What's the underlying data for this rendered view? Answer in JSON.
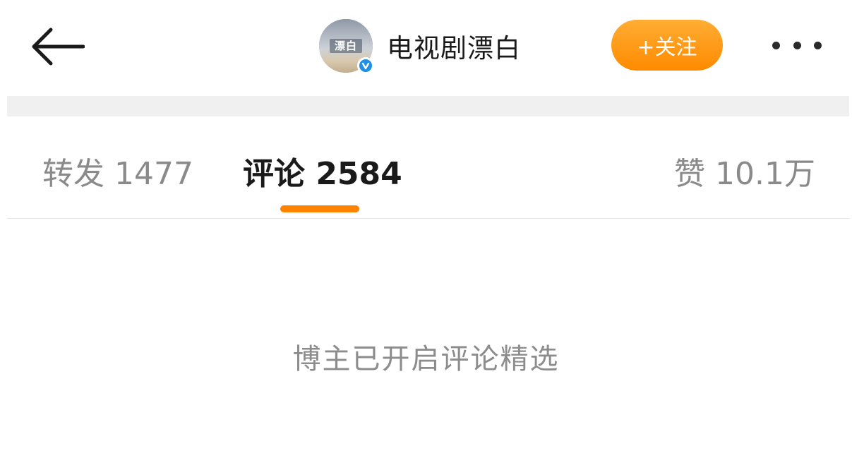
{
  "header": {
    "account_name": "电视剧漂白",
    "avatar_text": "漂白",
    "follow_label": "+关注"
  },
  "tabs": {
    "repost": "转发 1477",
    "comments": "评论 2584",
    "likes": "赞 10.1万"
  },
  "notice": "博主已开启评论精选",
  "colors": {
    "accent": "#ff8200",
    "verified": "#1f8fe8",
    "muted_text": "#8a8a8a"
  },
  "icons": {
    "back": "back-arrow-icon",
    "more": "more-icon",
    "verified": "verified-badge-icon"
  }
}
